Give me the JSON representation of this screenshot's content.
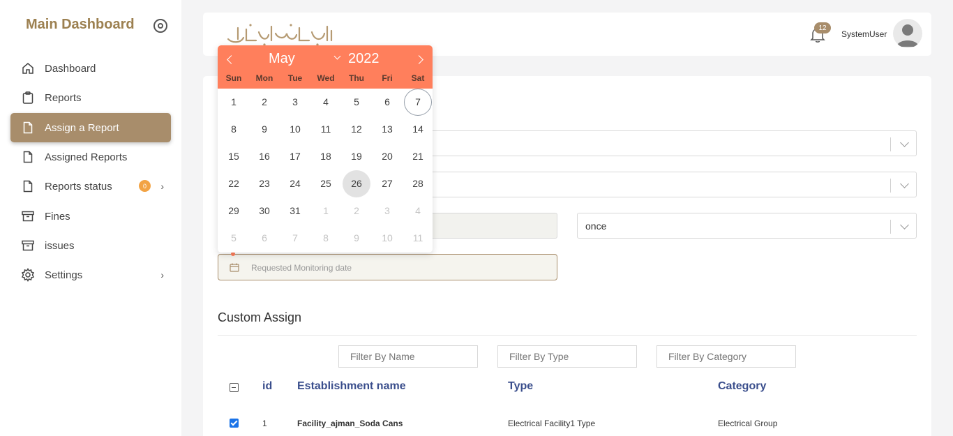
{
  "sidebar": {
    "brand": "Main Dashboard",
    "items": [
      {
        "label": "Dashboard",
        "icon": "home-icon"
      },
      {
        "label": "Reports",
        "icon": "clipboard-icon"
      },
      {
        "label": "Assign a Report",
        "icon": "file-icon",
        "active": true
      },
      {
        "label": "Assigned Reports",
        "icon": "file-icon"
      },
      {
        "label": "Reports status",
        "icon": "file-icon",
        "badge": "0"
      },
      {
        "label": "Fines",
        "icon": "archive-icon"
      },
      {
        "label": "issues",
        "icon": "archive-icon"
      },
      {
        "label": "Settings",
        "icon": "gear-icon"
      }
    ]
  },
  "header": {
    "notification_count": "12",
    "username": "SystemUser"
  },
  "form": {
    "frequency_value": "once",
    "date_placeholder": "Requested Monitoring date"
  },
  "calendar": {
    "month": "May",
    "year": "2022",
    "weekdays": [
      "Sun",
      "Mon",
      "Tue",
      "Wed",
      "Thu",
      "Fri",
      "Sat"
    ],
    "weeks": [
      [
        "1",
        "2",
        "3",
        "4",
        "5",
        "6",
        "7"
      ],
      [
        "8",
        "9",
        "10",
        "11",
        "12",
        "13",
        "14"
      ],
      [
        "15",
        "16",
        "17",
        "18",
        "19",
        "20",
        "21"
      ],
      [
        "22",
        "23",
        "24",
        "25",
        "26",
        "27",
        "28"
      ],
      [
        "29",
        "30",
        "31",
        "1",
        "2",
        "3",
        "4"
      ],
      [
        "5",
        "6",
        "7",
        "8",
        "9",
        "10",
        "11"
      ]
    ],
    "today": "7",
    "selected": "26"
  },
  "custom_assign": {
    "title": "Custom Assign",
    "filters": {
      "name_placeholder": "Filter By Name",
      "type_placeholder": "Filter By Type",
      "category_placeholder": "Filter By Category"
    },
    "columns": {
      "id": "id",
      "name": "Establishment name",
      "type": "Type",
      "category": "Category"
    },
    "rows": [
      {
        "id": "1",
        "name": "Facility_ajman_Soda Cans",
        "type": "Electrical Facility1 Type",
        "category": "Electrical Group",
        "checked": true
      }
    ]
  },
  "colors": {
    "accent": "#a88d6b",
    "calendar_header": "#ff7f5c",
    "table_header": "#3a4e8c",
    "badge": "#f2a344"
  }
}
